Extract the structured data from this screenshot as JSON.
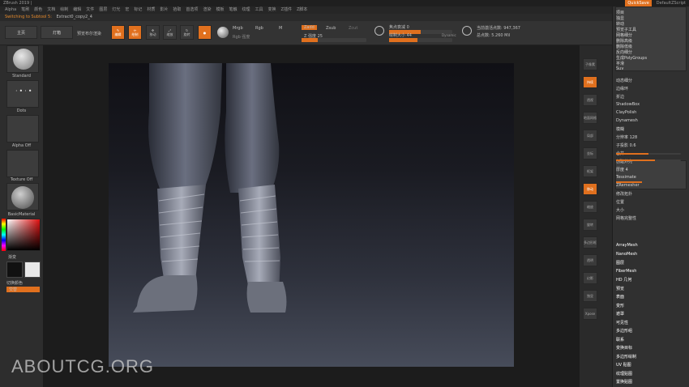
{
  "app": {
    "title": "ZBrush 2019 |",
    "quicksave": "QuickSave",
    "script": "DefaultZScript"
  },
  "menu": [
    "Alpha",
    "笔刷",
    "颜色",
    "文档",
    "绘制",
    "编辑",
    "文件",
    "图层",
    "灯光",
    "宏",
    "标记",
    "材质",
    "影片",
    "拾取",
    "首选项",
    "渲染",
    "模板",
    "笔触",
    "纹理",
    "工具",
    "变换",
    "Z插件",
    "Z脚本"
  ],
  "notice": {
    "label": "Switching to Subtool 5:",
    "filename": "Extract0_copy2_4"
  },
  "toolbar": {
    "home": "主页",
    "lightbox": "灯箱",
    "live_boolean": "预览布尔渲染",
    "icon_buttons": [
      "编辑",
      "绘制",
      "移动",
      "缩放",
      "旋转"
    ],
    "mrgb": "Mrgb",
    "rgb": "Rgb",
    "m": "M",
    "zadd": "Zadd",
    "zsub": "Zsub",
    "zcut": "Zcut",
    "rgb_intensity": "Rgb 强度",
    "z_intensity": "Z 强度 25",
    "focal_shift": "焦点衰减 0",
    "draw_size": "绘制大小 44",
    "dynamic": "Dynamic",
    "active_points": "当前激活点数: 947,367",
    "total_points": "总点数: 5.260 Mil",
    "z_intensity_level": 0.25,
    "focal_level": 0.5,
    "draw_size_level": 0.45
  },
  "left_tray": {
    "brush": "Standard",
    "stroke": "Dots",
    "alpha": "Alpha Off",
    "texture": "Texture Off",
    "material": "BasicMaterial",
    "gradient": "渐变",
    "switch_color": "切换颜色",
    "alternate": "交替"
  },
  "right_strip": [
    "子像素",
    "持续",
    "透视",
    "地面网格",
    "局部",
    "坐标",
    "框架",
    "移动",
    "缩放",
    "旋转",
    "多边形框",
    "透明",
    "幻影",
    "独显",
    "Xpose"
  ],
  "right_panel": {
    "items": [
      {
        "label": "项目"
      },
      {
        "label": "独显"
      },
      {
        "label": "转动"
      },
      {
        "label": "预览子工具"
      },
      {
        "label": "网格细分"
      },
      {
        "label": "删除高级"
      },
      {
        "label": "删除低级"
      },
      {
        "label": "反向细分"
      },
      {
        "label": "生成PolyGroups"
      },
      {
        "label": "平滑"
      },
      {
        "label": "Suv"
      },
      {
        "label": "动态细分"
      },
      {
        "label": "边缘环"
      },
      {
        "label": "折边"
      },
      {
        "label": "ShadowBox"
      },
      {
        "label": "ClayPolish"
      },
      {
        "label": "Dynamesh"
      },
      {
        "label": "模糊"
      },
      {
        "label": "分辨率 128"
      },
      {
        "label": "子投影 0.6"
      },
      {
        "label": "合并"
      },
      {
        "label": "创建外壳"
      },
      {
        "label": "厚度 4"
      },
      {
        "label": "Tessimate"
      },
      {
        "label": "ZRemesher"
      },
      {
        "label": "修改拓扑"
      },
      {
        "label": "位置"
      },
      {
        "label": "大小"
      },
      {
        "label": "网格完整性"
      },
      {
        "label": "ArrayMesh"
      },
      {
        "label": "NanoMesh"
      },
      {
        "label": "图层"
      },
      {
        "label": "FiberMesh"
      },
      {
        "label": "HD 几何"
      },
      {
        "label": "预览"
      },
      {
        "label": "表面"
      },
      {
        "label": "变形"
      },
      {
        "label": "遮罩"
      },
      {
        "label": "可见性"
      },
      {
        "label": "多边形组"
      },
      {
        "label": "联系"
      },
      {
        "label": "变换目标"
      },
      {
        "label": "多边形绘制"
      },
      {
        "label": "UV 贴图"
      },
      {
        "label": "纹理贴图"
      },
      {
        "label": "置换贴图"
      }
    ],
    "resolution_level": 0.5,
    "projection_level": 0.6,
    "thickness_level": 0.4
  },
  "watermark": "ABOUTCG.ORG",
  "colors": {
    "accent": "#e0701e",
    "panel": "#303030"
  }
}
